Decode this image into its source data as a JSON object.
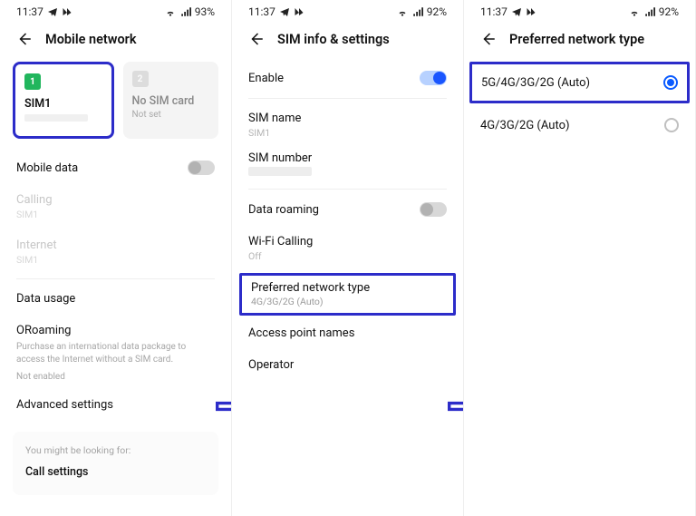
{
  "status": {
    "time": "11:37",
    "battery1": "93%",
    "battery23": "92%"
  },
  "screen1": {
    "title": "Mobile network",
    "sim1_badge": "1",
    "sim1_label": "SIM1",
    "sim2_badge": "2",
    "sim2_label": "No SIM card",
    "sim2_sub": "Not set",
    "mobile_data": "Mobile data",
    "calling": "Calling",
    "calling_sub": "SIM1",
    "internet": "Internet",
    "internet_sub": "SIM1",
    "data_usage": "Data usage",
    "oroaming": "ORoaming",
    "oroaming_desc": "Purchase an international data package to access the Internet without a SIM card.",
    "oroaming_state": "Not enabled",
    "advanced": "Advanced settings",
    "card_hint": "You might be looking for:",
    "card_link": "Call settings"
  },
  "screen2": {
    "title": "SIM info & settings",
    "enable": "Enable",
    "sim_name": "SIM name",
    "sim_name_val": "SIM1",
    "sim_number": "SIM number",
    "data_roaming": "Data roaming",
    "wifi_calling": "Wi-Fi Calling",
    "wifi_calling_val": "Off",
    "pref_net": "Preferred network type",
    "pref_net_val": "4G/3G/2G (Auto)",
    "apn": "Access point names",
    "operator": "Operator"
  },
  "screen3": {
    "title": "Preferred network type",
    "opt1": "5G/4G/3G/2G (Auto)",
    "opt2": "4G/3G/2G (Auto)"
  }
}
